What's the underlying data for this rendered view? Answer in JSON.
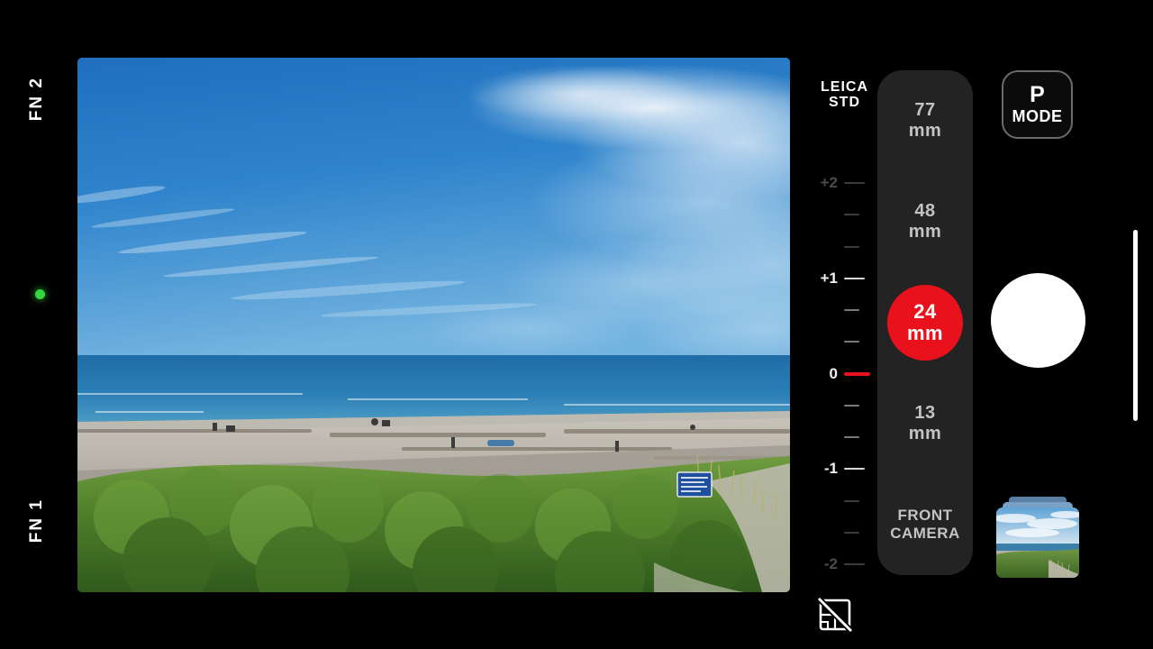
{
  "app": {
    "name": "leica-camera-viewfinder",
    "background_color": "#000000",
    "accent_color": "#e8111c"
  },
  "left_rail": {
    "fn2_label": "FN 2",
    "fn1_label": "FN 1",
    "status_dot_color": "#35d63f",
    "status_dot_name": "recording-ready-indicator"
  },
  "viewfinder": {
    "scene_description": "beach-landscape-preview",
    "sky_color": "#2d7cc4",
    "sea_color": "#1e6fa8",
    "sand_color": "#b9b4ab",
    "vegetation_color": "#4d7b2c"
  },
  "exposure": {
    "profile_line1": "LEICA",
    "profile_line2": "STD",
    "current_value": "0",
    "marks": [
      {
        "label": "+2",
        "dim": true,
        "tick": "major"
      },
      {
        "label": "",
        "dim": true,
        "tick": "minor"
      },
      {
        "label": "",
        "dim": true,
        "tick": "minor"
      },
      {
        "label": "+1",
        "dim": false,
        "tick": "major"
      },
      {
        "label": "",
        "dim": false,
        "tick": "minor"
      },
      {
        "label": "",
        "dim": false,
        "tick": "minor"
      },
      {
        "label": "0",
        "dim": false,
        "tick": "current"
      },
      {
        "label": "",
        "dim": false,
        "tick": "minor"
      },
      {
        "label": "",
        "dim": false,
        "tick": "minor"
      },
      {
        "label": "-1",
        "dim": false,
        "tick": "major"
      },
      {
        "label": "",
        "dim": true,
        "tick": "minor"
      },
      {
        "label": "",
        "dim": true,
        "tick": "minor"
      },
      {
        "label": "-2",
        "dim": true,
        "tick": "major"
      }
    ],
    "grid_icon_name": "grid-off-icon",
    "grid_state": "off"
  },
  "lens_selector": {
    "panel_color": "#232323",
    "selected": "24",
    "options": [
      {
        "focal": "77",
        "unit": "mm",
        "selected": false
      },
      {
        "focal": "48",
        "unit": "mm",
        "selected": false
      },
      {
        "focal": "24",
        "unit": "mm",
        "selected": true
      },
      {
        "focal": "13",
        "unit": "mm",
        "selected": false
      }
    ],
    "front_camera_line1": "FRONT",
    "front_camera_line2": "CAMERA"
  },
  "controls": {
    "mode_letter": "P",
    "mode_word": "MODE",
    "shutter_name": "shutter-button",
    "shutter_color": "#ffffff",
    "gallery_thumbnail_name": "gallery-thumbnail",
    "home_indicator_name": "home-indicator"
  }
}
